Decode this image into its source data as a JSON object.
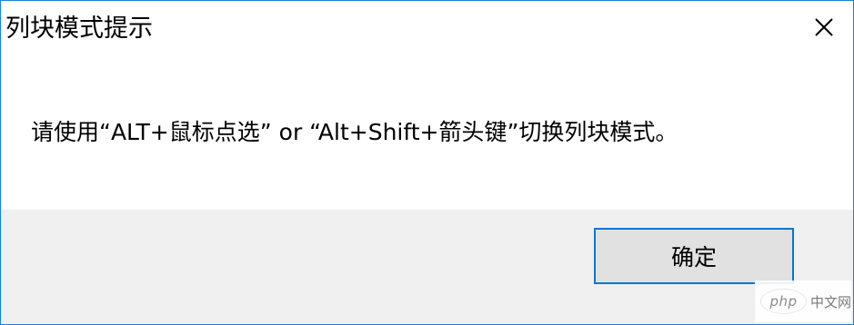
{
  "dialog": {
    "title": "列块模式提示",
    "message": "请使用“ALT+鼠标点选” or “Alt+Shift+箭头键”切换列块模式。",
    "ok_label": "确定"
  },
  "watermark": {
    "logo_text": "php",
    "site_text": "中文网"
  },
  "colors": {
    "border": "#1883d7",
    "footer_bg": "#f0f0f0",
    "button_bg": "#e1e1e1",
    "button_border": "#0078d7"
  }
}
